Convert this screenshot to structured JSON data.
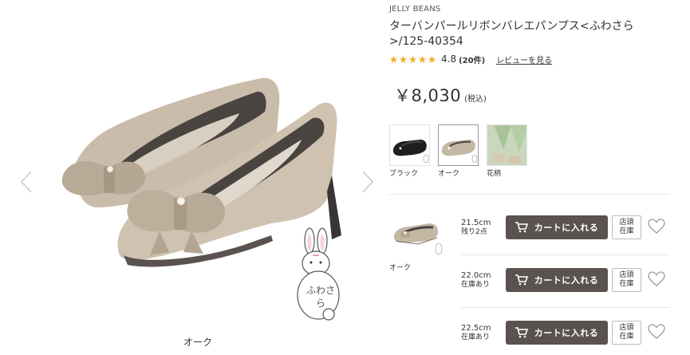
{
  "gallery": {
    "caption": "オーク",
    "badge_text": "ふわさら"
  },
  "product": {
    "brand": "JELLY BEANS",
    "title": "ターバンパールリボンバレエパンプス<ふわさら>/125-40354",
    "rating_score": "4.8",
    "rating_count": "(20件)",
    "rating_value": 4.8,
    "rating_max": 5,
    "review_link": "レビューを見る",
    "price": "￥8,030",
    "tax_label": "(税込)"
  },
  "colors": {
    "accent": "#5a524f",
    "star": "#f2b230",
    "shoe_beige": "#c4b7a4"
  },
  "swatches": [
    {
      "label": "ブラック",
      "selected": false
    },
    {
      "label": "オーク",
      "selected": true
    },
    {
      "label": "花柄",
      "selected": false
    }
  ],
  "variant": {
    "color_label": "オーク"
  },
  "sizes": [
    {
      "size": "21.5cm",
      "stock": "残り2点",
      "cart_label": "カートに入れる",
      "store_line1": "店頭",
      "store_line2": "在庫"
    },
    {
      "size": "22.0cm",
      "stock": "在庫あり",
      "cart_label": "カートに入れる",
      "store_line1": "店頭",
      "store_line2": "在庫"
    },
    {
      "size": "22.5cm",
      "stock": "在庫あり",
      "cart_label": "カートに入れる",
      "store_line1": "店頭",
      "store_line2": "在庫"
    }
  ]
}
